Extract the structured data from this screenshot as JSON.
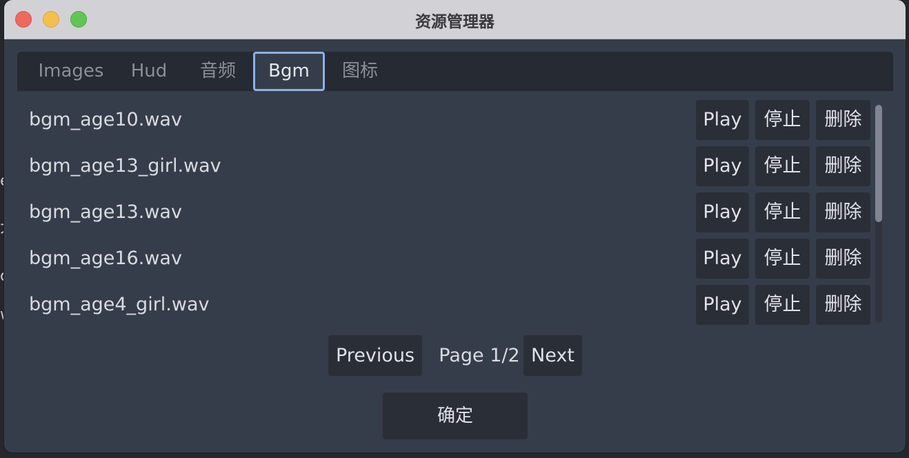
{
  "window": {
    "title": "资源管理器"
  },
  "tabs": [
    {
      "label": "Images",
      "active": false
    },
    {
      "label": "Hud",
      "active": false
    },
    {
      "label": "音频",
      "active": false
    },
    {
      "label": "Bgm",
      "active": true
    },
    {
      "label": "图标",
      "active": false
    }
  ],
  "files": [
    {
      "name": "bgm_age10.wav",
      "play": "Play",
      "stop": "停止",
      "delete": "删除"
    },
    {
      "name": "bgm_age13_girl.wav",
      "play": "Play",
      "stop": "停止",
      "delete": "删除"
    },
    {
      "name": "bgm_age13.wav",
      "play": "Play",
      "stop": "停止",
      "delete": "删除"
    },
    {
      "name": "bgm_age16.wav",
      "play": "Play",
      "stop": "停止",
      "delete": "删除"
    },
    {
      "name": "bgm_age4_girl.wav",
      "play": "Play",
      "stop": "停止",
      "delete": "删除"
    }
  ],
  "pagination": {
    "previous": "Previous",
    "page_label": "Page 1/2",
    "next": "Next"
  },
  "confirm_label": "确定",
  "colors": {
    "panel_bg": "#363d4a",
    "tab_bar_bg": "#262a33",
    "active_tab_border": "#8eb1e8",
    "button_bg": "#2a2e37"
  }
}
